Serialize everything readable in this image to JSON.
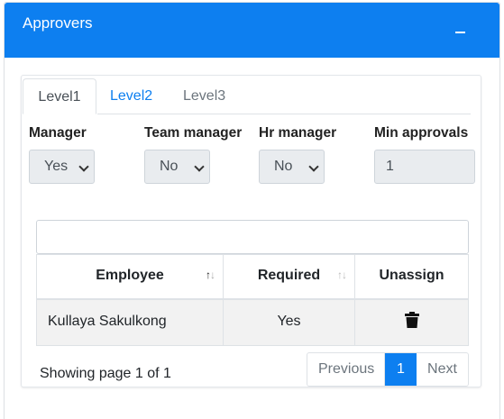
{
  "card": {
    "title": "Approvers"
  },
  "tabs": [
    {
      "label": "Level1"
    },
    {
      "label": "Level2"
    },
    {
      "label": "Level3"
    }
  ],
  "fields": {
    "manager": {
      "label": "Manager",
      "value": "Yes"
    },
    "team_manager": {
      "label": "Team manager",
      "value": "No"
    },
    "hr_manager": {
      "label": "Hr manager",
      "value": "No"
    },
    "min_approvals": {
      "label": "Min approvals",
      "value": "1"
    }
  },
  "table": {
    "headers": [
      "Employee",
      "Required",
      "Unassign"
    ],
    "rows": [
      {
        "employee": "Kullaya Sakulkong",
        "required": "Yes"
      }
    ]
  },
  "pagination": {
    "showing": "Showing page 1 of 1",
    "prev": "Previous",
    "current": "1",
    "next": "Next"
  },
  "colors": {
    "primary": "#0d7ff0"
  },
  "icons": {
    "collapse": "minus-icon",
    "unassign": "trash-icon",
    "sort": "sort-icon"
  }
}
